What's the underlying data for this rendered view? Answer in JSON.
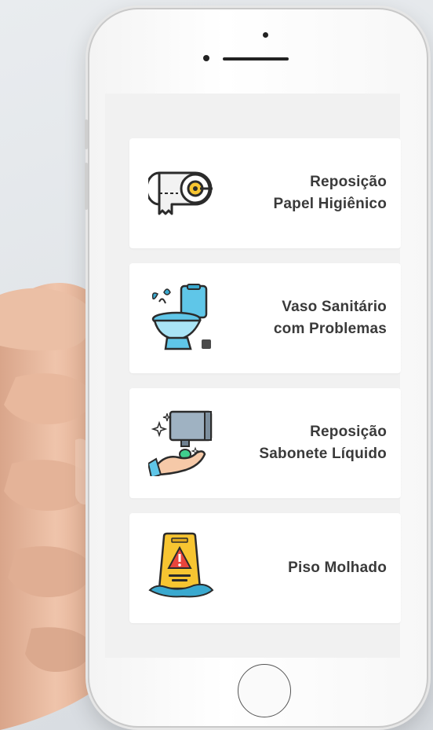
{
  "options": [
    {
      "line1": "Reposição",
      "line2": "Papel Higiênico",
      "icon": "toilet-paper-icon"
    },
    {
      "line1": "Vaso Sanitário",
      "line2": "com Problemas",
      "icon": "toilet-icon"
    },
    {
      "line1": "Reposição",
      "line2": "Sabonete Líquido",
      "icon": "soap-dispenser-icon"
    },
    {
      "line1": "Piso Molhado",
      "line2": "",
      "icon": "wet-floor-sign-icon"
    }
  ],
  "colors": {
    "screen_bg": "#f1f1f1",
    "card_bg": "#ffffff",
    "label_text": "#3a3a3a",
    "accent_blue": "#5fc6e8",
    "accent_yellow": "#f7c531"
  }
}
